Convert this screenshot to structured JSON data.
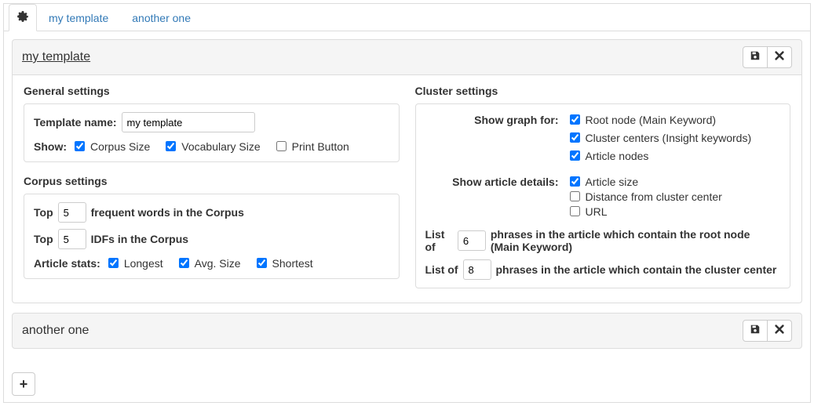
{
  "tabs": {
    "t1": "my template",
    "t2": "another one"
  },
  "panel1": {
    "title": "my template"
  },
  "panel2": {
    "title": "another one"
  },
  "general": {
    "heading": "General settings",
    "name_label": "Template name:",
    "name_value": "my template",
    "show_label": "Show:",
    "corpus_size": "Corpus Size",
    "vocab_size": "Vocabulary Size",
    "print_button": "Print Button"
  },
  "corpus": {
    "heading": "Corpus settings",
    "top_label": "Top",
    "freq_value": "5",
    "freq_suffix": "frequent words in the Corpus",
    "idf_value": "5",
    "idf_suffix": "IDFs in the Corpus",
    "stats_label": "Article stats:",
    "longest": "Longest",
    "avg": "Avg. Size",
    "shortest": "Shortest"
  },
  "cluster": {
    "heading": "Cluster settings",
    "show_graph_label": "Show graph for:",
    "root_node": "Root node (Main Keyword)",
    "cluster_centers": "Cluster centers (Insight keywords)",
    "article_nodes": "Article nodes",
    "show_details_label": "Show article details:",
    "article_size": "Article size",
    "distance": "Distance from cluster center",
    "url": "URL",
    "list_of": "List of",
    "list1_value": "6",
    "list1_suffix": "phrases in the article which contain the root node (Main Keyword)",
    "list2_value": "8",
    "list2_suffix": "phrases in the article which contain the cluster center"
  }
}
